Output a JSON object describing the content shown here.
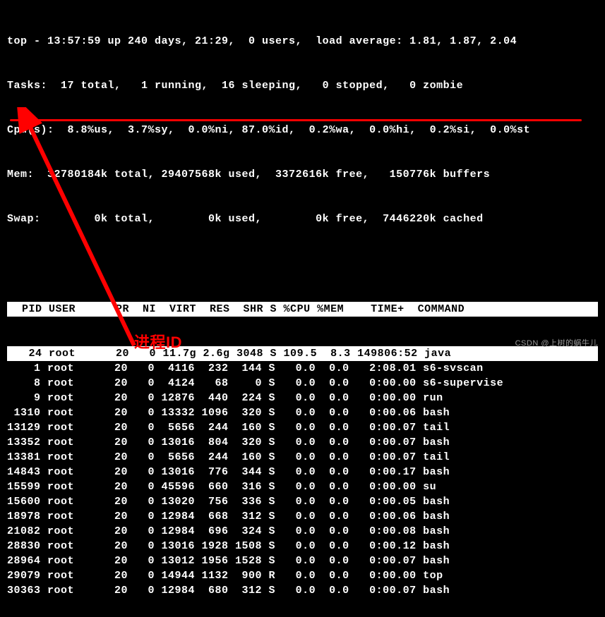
{
  "summary": {
    "line1": "top - 13:57:59 up 240 days, 21:29,  0 users,  load average: 1.81, 1.87, 2.04",
    "line2": "Tasks:  17 total,   1 running,  16 sleeping,   0 stopped,   0 zombie",
    "line3": "Cpu(s):  8.8%us,  3.7%sy,  0.0%ni, 87.0%id,  0.2%wa,  0.0%hi,  0.2%si,  0.0%st",
    "line4": "Mem:  32780184k total, 29407568k used,  3372616k free,   150776k buffers",
    "line5": "Swap:        0k total,        0k used,        0k free,  7446220k cached"
  },
  "columns": "  PID USER      PR  NI  VIRT  RES  SHR S %CPU %MEM    TIME+  COMMAND",
  "processes": [
    {
      "pid": "24",
      "user": "root",
      "pr": "20",
      "ni": "0",
      "virt": "11.7g",
      "res": "2.6g",
      "shr": "3048",
      "s": "S",
      "cpu": "109.5",
      "mem": "8.3",
      "time": "149806:52",
      "cmd": "java"
    },
    {
      "pid": "1",
      "user": "root",
      "pr": "20",
      "ni": "0",
      "virt": "4116",
      "res": "232",
      "shr": "144",
      "s": "S",
      "cpu": "0.0",
      "mem": "0.0",
      "time": "2:08.01",
      "cmd": "s6-svscan"
    },
    {
      "pid": "8",
      "user": "root",
      "pr": "20",
      "ni": "0",
      "virt": "4124",
      "res": "68",
      "shr": "0",
      "s": "S",
      "cpu": "0.0",
      "mem": "0.0",
      "time": "0:00.00",
      "cmd": "s6-supervise"
    },
    {
      "pid": "9",
      "user": "root",
      "pr": "20",
      "ni": "0",
      "virt": "12876",
      "res": "440",
      "shr": "224",
      "s": "S",
      "cpu": "0.0",
      "mem": "0.0",
      "time": "0:00.00",
      "cmd": "run"
    },
    {
      "pid": "1310",
      "user": "root",
      "pr": "20",
      "ni": "0",
      "virt": "13332",
      "res": "1096",
      "shr": "320",
      "s": "S",
      "cpu": "0.0",
      "mem": "0.0",
      "time": "0:00.06",
      "cmd": "bash"
    },
    {
      "pid": "13129",
      "user": "root",
      "pr": "20",
      "ni": "0",
      "virt": "5656",
      "res": "244",
      "shr": "160",
      "s": "S",
      "cpu": "0.0",
      "mem": "0.0",
      "time": "0:00.07",
      "cmd": "tail"
    },
    {
      "pid": "13352",
      "user": "root",
      "pr": "20",
      "ni": "0",
      "virt": "13016",
      "res": "804",
      "shr": "320",
      "s": "S",
      "cpu": "0.0",
      "mem": "0.0",
      "time": "0:00.07",
      "cmd": "bash"
    },
    {
      "pid": "13381",
      "user": "root",
      "pr": "20",
      "ni": "0",
      "virt": "5656",
      "res": "244",
      "shr": "160",
      "s": "S",
      "cpu": "0.0",
      "mem": "0.0",
      "time": "0:00.07",
      "cmd": "tail"
    },
    {
      "pid": "14843",
      "user": "root",
      "pr": "20",
      "ni": "0",
      "virt": "13016",
      "res": "776",
      "shr": "344",
      "s": "S",
      "cpu": "0.0",
      "mem": "0.0",
      "time": "0:00.17",
      "cmd": "bash"
    },
    {
      "pid": "15599",
      "user": "root",
      "pr": "20",
      "ni": "0",
      "virt": "45596",
      "res": "660",
      "shr": "316",
      "s": "S",
      "cpu": "0.0",
      "mem": "0.0",
      "time": "0:00.00",
      "cmd": "su"
    },
    {
      "pid": "15600",
      "user": "root",
      "pr": "20",
      "ni": "0",
      "virt": "13020",
      "res": "756",
      "shr": "336",
      "s": "S",
      "cpu": "0.0",
      "mem": "0.0",
      "time": "0:00.05",
      "cmd": "bash"
    },
    {
      "pid": "18978",
      "user": "root",
      "pr": "20",
      "ni": "0",
      "virt": "12984",
      "res": "668",
      "shr": "312",
      "s": "S",
      "cpu": "0.0",
      "mem": "0.0",
      "time": "0:00.06",
      "cmd": "bash"
    },
    {
      "pid": "21082",
      "user": "root",
      "pr": "20",
      "ni": "0",
      "virt": "12984",
      "res": "696",
      "shr": "324",
      "s": "S",
      "cpu": "0.0",
      "mem": "0.0",
      "time": "0:00.08",
      "cmd": "bash"
    },
    {
      "pid": "28830",
      "user": "root",
      "pr": "20",
      "ni": "0",
      "virt": "13016",
      "res": "1928",
      "shr": "1508",
      "s": "S",
      "cpu": "0.0",
      "mem": "0.0",
      "time": "0:00.12",
      "cmd": "bash"
    },
    {
      "pid": "28964",
      "user": "root",
      "pr": "20",
      "ni": "0",
      "virt": "13012",
      "res": "1956",
      "shr": "1528",
      "s": "S",
      "cpu": "0.0",
      "mem": "0.0",
      "time": "0:00.07",
      "cmd": "bash"
    },
    {
      "pid": "29079",
      "user": "root",
      "pr": "20",
      "ni": "0",
      "virt": "14944",
      "res": "1132",
      "shr": "900",
      "s": "R",
      "cpu": "0.0",
      "mem": "0.0",
      "time": "0:00.00",
      "cmd": "top"
    },
    {
      "pid": "30363",
      "user": "root",
      "pr": "20",
      "ni": "0",
      "virt": "12984",
      "res": "680",
      "shr": "312",
      "s": "S",
      "cpu": "0.0",
      "mem": "0.0",
      "time": "0:00.07",
      "cmd": "bash"
    }
  ],
  "annotation": {
    "label": "进程ID"
  },
  "watermark": "CSDN @上树的蜗牛儿"
}
